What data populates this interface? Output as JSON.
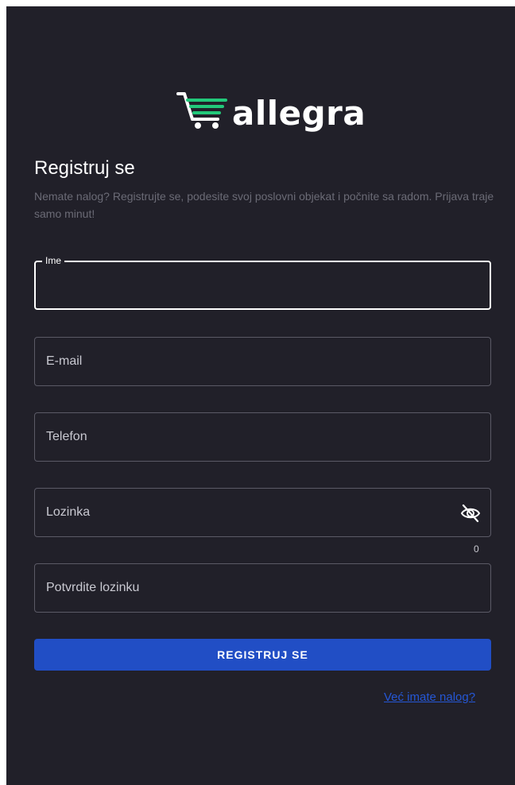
{
  "brand": {
    "name": "allegra",
    "accent_color": "#22c97a",
    "logo_icon": "shopping-cart-icon"
  },
  "header": {
    "title": "Registruj se",
    "subtitle": "Nemate nalog? Registrujte se, podesite svoj poslovni objekat i počnite sa radom. Prijava traje samo minut!"
  },
  "form": {
    "name_label": "Ime",
    "name_value": "",
    "email_label": "E-mail",
    "phone_label": "Telefon",
    "password_label": "Lozinka",
    "password_toggle_icon": "eye-off-icon",
    "password_counter": "0",
    "confirm_label": "Potvrdite lozinku",
    "submit_label": "REGISTRUJ SE",
    "login_link": "Već imate nalog?"
  },
  "colors": {
    "background": "#212029",
    "primary_button": "#214ec5",
    "link": "#2557d6"
  }
}
